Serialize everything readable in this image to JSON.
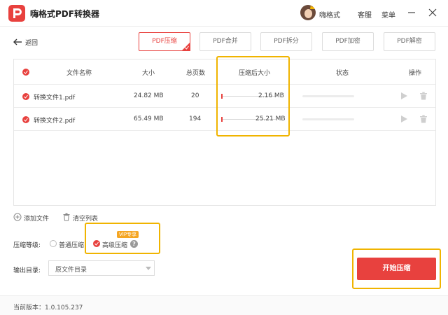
{
  "app": {
    "title": "嗨格式PDF转换器",
    "accent_color": "#e8413e",
    "highlight_color": "#f0b400"
  },
  "header": {
    "user_name": "嗨格式",
    "service_label": "客服",
    "menu_label": "菜单",
    "icons": [
      "app-logo-icon",
      "avatar",
      "minimize-icon",
      "close-icon"
    ]
  },
  "toolbar": {
    "back_label": "返回",
    "tabs": [
      {
        "label": "PDF压缩",
        "active": true
      },
      {
        "label": "PDF合并",
        "active": false
      },
      {
        "label": "PDF拆分",
        "active": false
      },
      {
        "label": "PDF加密",
        "active": false
      },
      {
        "label": "PDF解密",
        "active": false
      }
    ]
  },
  "table": {
    "columns": [
      "文件名称",
      "大小",
      "总页数",
      "压缩后大小",
      "状态",
      "操作"
    ],
    "rows": [
      {
        "name": "转换文件1.pdf",
        "size": "24.82 MB",
        "pages": "20",
        "compressed_size": "2.16 MB",
        "checked": true
      },
      {
        "name": "转换文件2.pdf",
        "size": "65.49 MB",
        "pages": "194",
        "compressed_size": "25.21 MB",
        "checked": true
      }
    ]
  },
  "actions": {
    "add_file": "添加文件",
    "clear_list": "清空列表"
  },
  "compression": {
    "label": "压缩等级:",
    "options": [
      {
        "label": "普通压缩",
        "selected": false
      },
      {
        "label": "高级压缩",
        "selected": true
      }
    ],
    "vip_badge": "VIP专享",
    "help_glyph": "?"
  },
  "output": {
    "label": "输出目录:",
    "value": "原文件目录"
  },
  "start_button": "开始压缩",
  "footer": {
    "version": "当前版本：1.0.105.237"
  }
}
